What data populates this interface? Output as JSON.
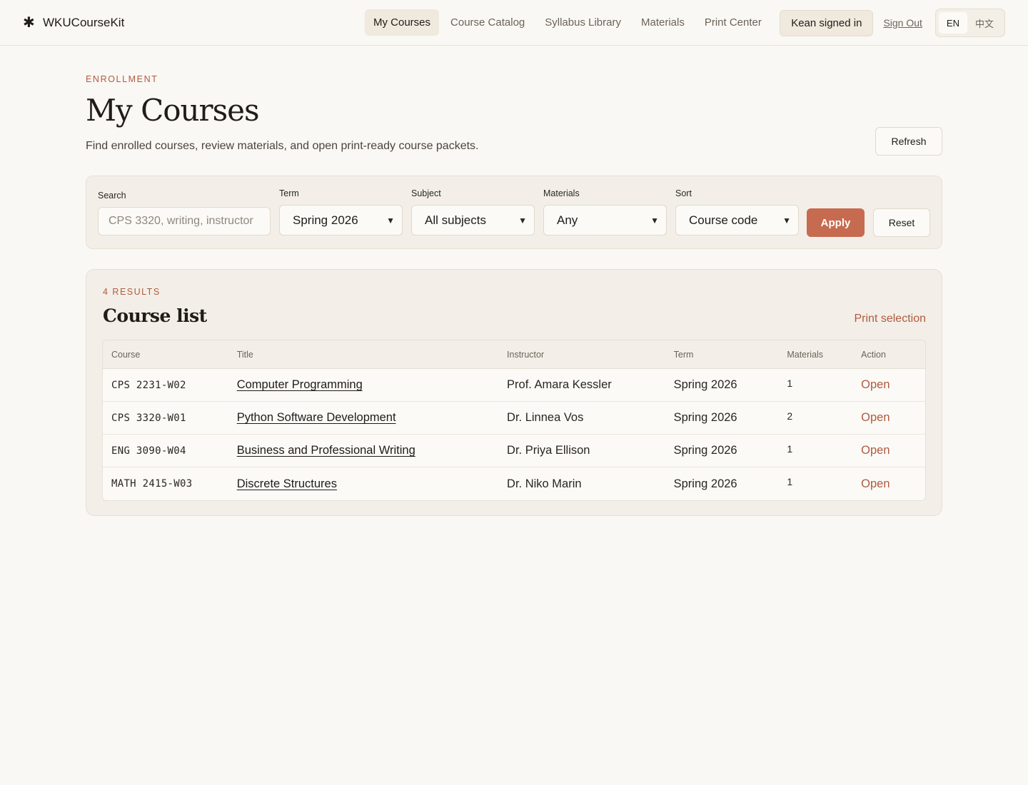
{
  "app": {
    "name": "WKUCourseKit",
    "logo_icon": "asterisk-icon"
  },
  "nav": {
    "items": [
      {
        "label": "My Courses",
        "active": true
      },
      {
        "label": "Course Catalog",
        "active": false
      },
      {
        "label": "Syllabus Library",
        "active": false
      },
      {
        "label": "Materials",
        "active": false
      },
      {
        "label": "Print Center",
        "active": false
      }
    ],
    "signed_in": "Kean signed in",
    "sign_out": "Sign Out",
    "languages": [
      {
        "label": "EN",
        "active": true
      },
      {
        "label": "中文",
        "active": false
      }
    ]
  },
  "header": {
    "eyebrow": "ENROLLMENT",
    "title": "My Courses",
    "subtitle": "Find enrolled courses, review materials, and open print-ready course packets.",
    "refresh_label": "Refresh"
  },
  "filters": {
    "search_label": "Search",
    "search_placeholder": "CPS 3320, writing, instructor",
    "term_label": "Term",
    "term_value": "Spring 2026",
    "subject_label": "Subject",
    "subject_value": "All subjects",
    "materials_label": "Materials",
    "materials_value": "Any",
    "sort_label": "Sort",
    "sort_value": "Course code",
    "apply_label": "Apply",
    "reset_label": "Reset"
  },
  "results": {
    "count_label": "4 RESULTS",
    "title": "Course list",
    "print_selection": "Print selection",
    "columns": [
      "Course",
      "Title",
      "Instructor",
      "Term",
      "Materials",
      "Action"
    ],
    "rows": [
      {
        "course": "CPS 2231-W02",
        "title": "Computer Programming",
        "instructor": "Prof. Amara Kessler",
        "term": "Spring 2026",
        "materials": "1",
        "action": "Open"
      },
      {
        "course": "CPS 3320-W01",
        "title": "Python Software Development",
        "instructor": "Dr. Linnea Vos",
        "term": "Spring 2026",
        "materials": "2",
        "action": "Open"
      },
      {
        "course": "ENG 3090-W04",
        "title": "Business and Professional Writing",
        "instructor": "Dr. Priya Ellison",
        "term": "Spring 2026",
        "materials": "1",
        "action": "Open"
      },
      {
        "course": "MATH 2415-W03",
        "title": "Discrete Structures",
        "instructor": "Dr. Niko Marin",
        "term": "Spring 2026",
        "materials": "1",
        "action": "Open"
      }
    ]
  },
  "colors": {
    "accent": "#c66b50",
    "accent_text": "#b05a3e",
    "background": "#faf8f4",
    "panel": "#f3efe8"
  }
}
